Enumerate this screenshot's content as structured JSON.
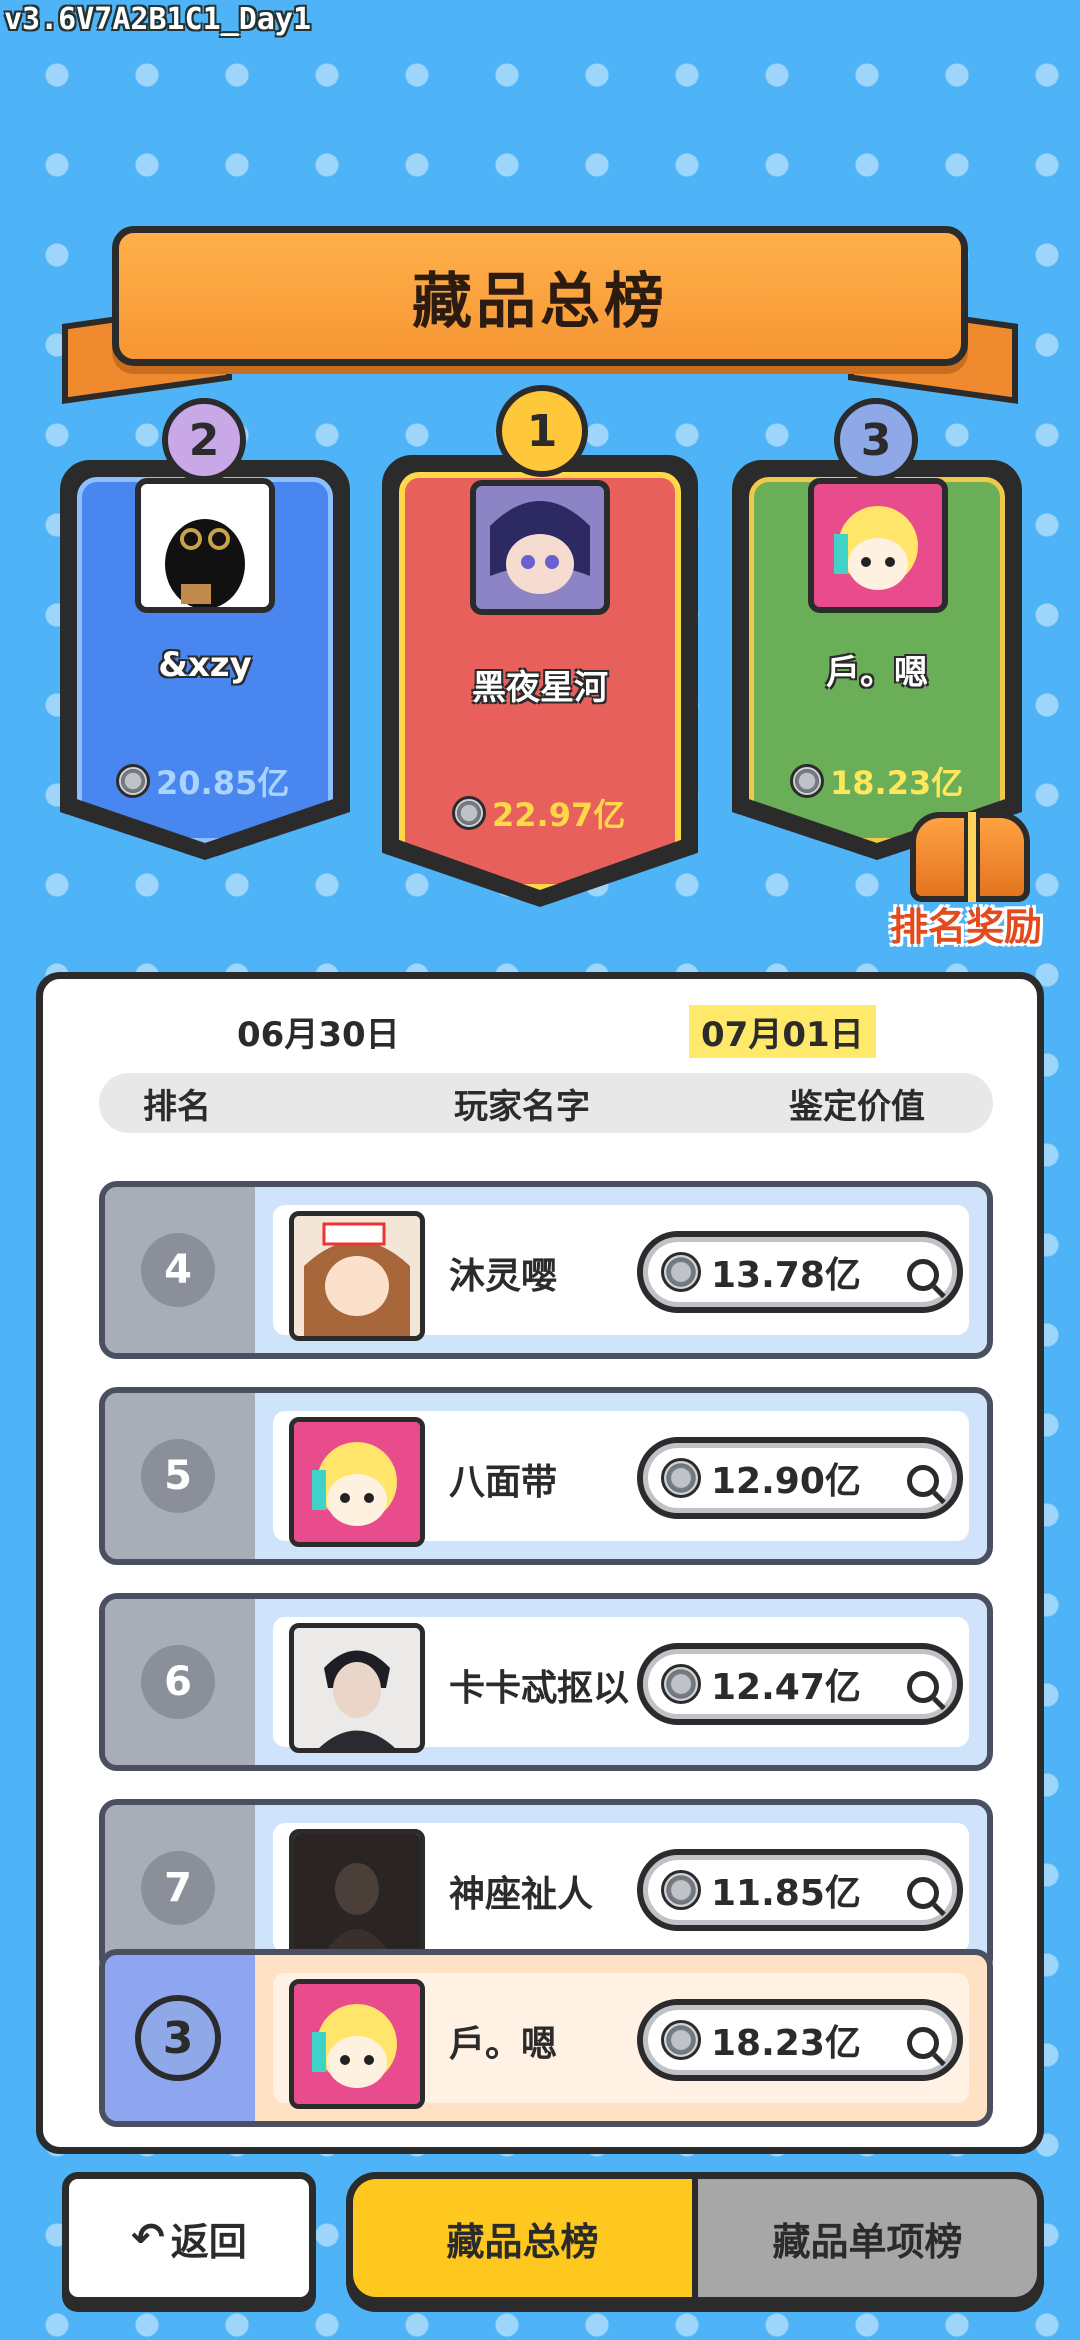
{
  "version": "v3.6V7A2B1C1_Day1",
  "title": "藏品总榜",
  "podium": [
    {
      "rank": "2",
      "name": "&xzy",
      "value": "20.85亿",
      "value_color": "#a8d4ff"
    },
    {
      "rank": "1",
      "name": "黑夜星河",
      "value": "22.97亿",
      "value_color": "#ffd84a"
    },
    {
      "rank": "3",
      "name": "戶。嗯",
      "value": "18.23亿",
      "value_color": "#ffe65a"
    }
  ],
  "reward_label": "排名奖励",
  "dates": [
    "06月30日",
    "07月01日"
  ],
  "columns": [
    "排名",
    "玩家名字",
    "鉴定价值"
  ],
  "rows": [
    {
      "rank": "4",
      "name": "沐灵嘤",
      "value": "13.78亿"
    },
    {
      "rank": "5",
      "name": "八面带",
      "value": "12.90亿"
    },
    {
      "rank": "6",
      "name": "卡卡忒抠以",
      "value": "12.47亿"
    },
    {
      "rank": "7",
      "name": "神座祉人",
      "value": "11.85亿"
    }
  ],
  "my_row": {
    "rank": "3",
    "name": "戶。嗯",
    "value": "18.23亿"
  },
  "buttons": {
    "back": "返回",
    "tab_total": "藏品总榜",
    "tab_single": "藏品单项榜"
  },
  "icons": {
    "back": "undo-arrow-icon",
    "search": "search-icon",
    "coin": "coin-icon",
    "chest": "treasure-chest-icon"
  }
}
